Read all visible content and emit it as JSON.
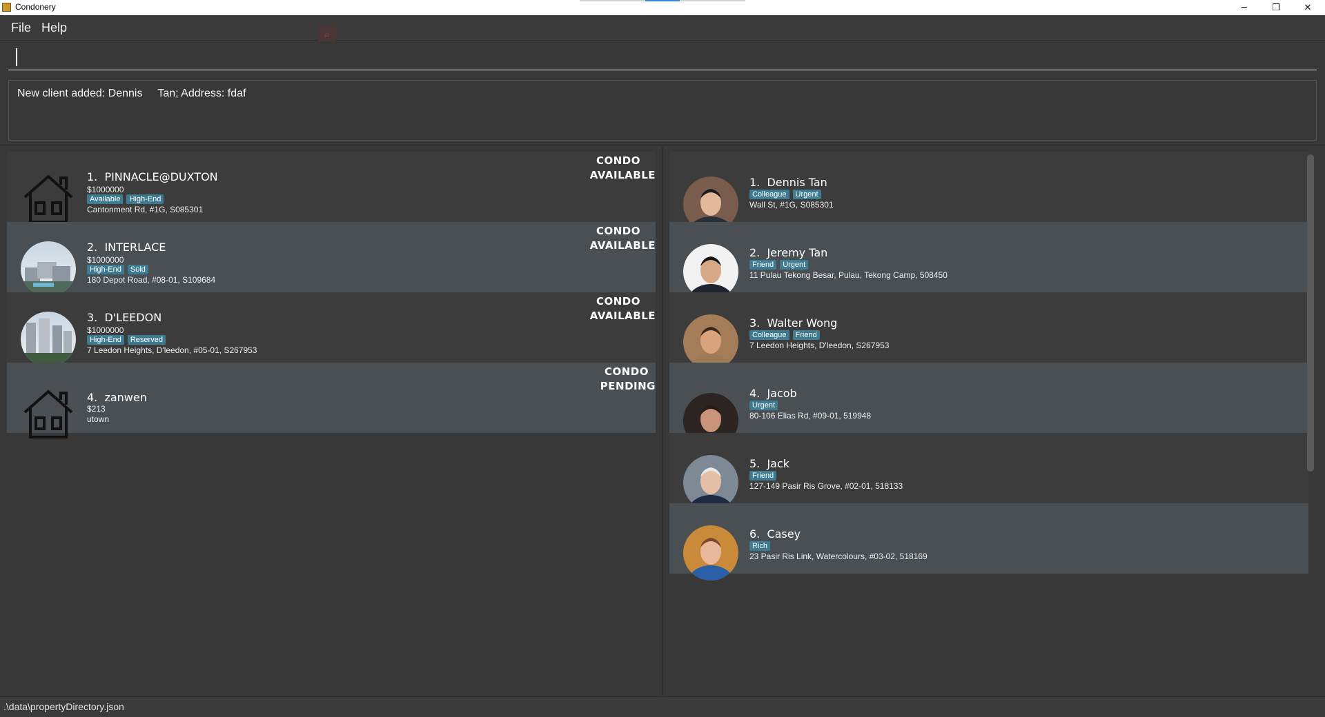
{
  "window": {
    "title": "Condonery",
    "minimize_glyph": "─",
    "maximize_glyph": "❐",
    "close_glyph": "✕"
  },
  "menu": {
    "file": "File",
    "help": "Help"
  },
  "command": {
    "value": "",
    "placeholder": ""
  },
  "result": {
    "text": "New client added: Dennis     Tan; Address: fdaf"
  },
  "properties": [
    {
      "index": "1.",
      "name": "PINNACLE@DUXTON",
      "price": "$1000000",
      "tags": [
        "Available",
        "High-End"
      ],
      "address": "Cantonment Rd, #1G, S085301",
      "type": "CONDO",
      "status": "AVAILABLE",
      "image": "house-icon"
    },
    {
      "index": "2.",
      "name": "INTERLACE",
      "price": "$1000000",
      "tags": [
        "High-End",
        "Sold"
      ],
      "address": "180 Depot Road, #08-01, S109684",
      "type": "CONDO",
      "status": "AVAILABLE",
      "image": "building-photo"
    },
    {
      "index": "3.",
      "name": "D'LEEDON",
      "price": "$1000000",
      "tags": [
        "High-End",
        "Reserved"
      ],
      "address": "7 Leedon Heights, D'leedon, #05-01, S267953",
      "type": "CONDO",
      "status": "AVAILABLE",
      "image": "building-photo"
    },
    {
      "index": "4.",
      "name": "zanwen",
      "price": "$213",
      "tags": [],
      "address": "utown",
      "type": "CONDO",
      "status": "PENDING",
      "image": "house-icon"
    }
  ],
  "clients": [
    {
      "index": "1.",
      "name": "Dennis Tan",
      "tags": [
        "Colleague",
        "Urgent"
      ],
      "address": "Wall St, #1G, S085301"
    },
    {
      "index": "2.",
      "name": "Jeremy Tan",
      "tags": [
        "Friend",
        "Urgent"
      ],
      "address": "11 Pulau Tekong Besar, Pulau, Tekong Camp, 508450"
    },
    {
      "index": "3.",
      "name": "Walter Wong",
      "tags": [
        "Colleague",
        "Friend"
      ],
      "address": "7 Leedon Heights, D'leedon, S267953"
    },
    {
      "index": "4.",
      "name": "Jacob",
      "tags": [
        "Urgent"
      ],
      "address": "80-106 Elias Rd, #09-01, 519948"
    },
    {
      "index": "5.",
      "name": "Jack",
      "tags": [
        "Friend"
      ],
      "address": "127-149 Pasir Ris Grove, #02-01, 518133"
    },
    {
      "index": "6.",
      "name": "Casey",
      "tags": [
        "Rich"
      ],
      "address": "23 Pasir Ris Link, Watercolours, #03-02, 518169"
    }
  ],
  "status": {
    "path": ".\\data\\propertyDirectory.json"
  },
  "colors": {
    "tag": "#3e7b91",
    "card_dark": "#3c3c3c",
    "card_light": "#4a4f53",
    "background": "#383838"
  }
}
